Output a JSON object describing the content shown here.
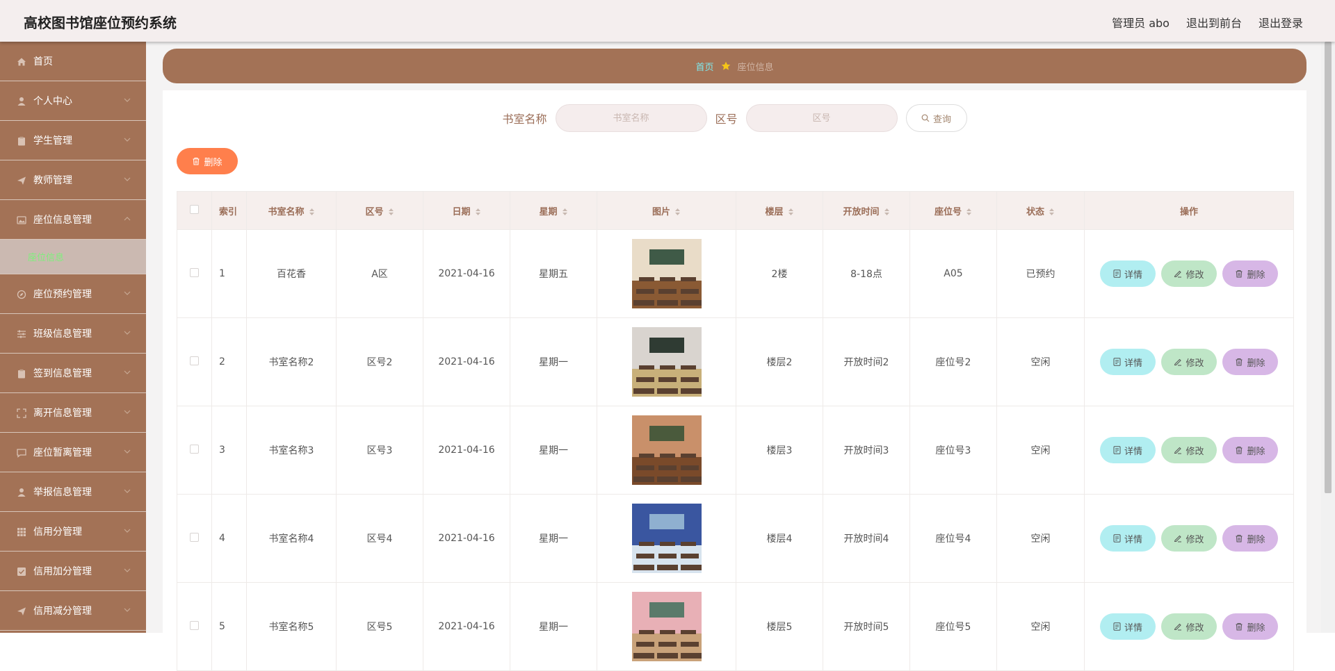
{
  "app": {
    "title": "高校图书馆座位预约系统"
  },
  "header": {
    "user_label": "管理员 abo",
    "to_front_label": "退出到前台",
    "logout_label": "退出登录"
  },
  "sidebar": {
    "items": [
      {
        "label": "首页",
        "icon": "home-icon"
      },
      {
        "label": "个人中心",
        "icon": "user-icon"
      },
      {
        "label": "学生管理",
        "icon": "clipboard-icon"
      },
      {
        "label": "教师管理",
        "icon": "send-icon"
      },
      {
        "label": "座位信息管理",
        "icon": "picture-icon",
        "expanded": true
      },
      {
        "label": "座位预约管理",
        "icon": "compass-icon"
      },
      {
        "label": "班级信息管理",
        "icon": "sliders-icon"
      },
      {
        "label": "签到信息管理",
        "icon": "clipboard-icon"
      },
      {
        "label": "离开信息管理",
        "icon": "fullscreen-icon"
      },
      {
        "label": "座位暂离管理",
        "icon": "message-icon"
      },
      {
        "label": "举报信息管理",
        "icon": "user-icon"
      },
      {
        "label": "信用分管理",
        "icon": "grid-icon"
      },
      {
        "label": "信用加分管理",
        "icon": "checklist-icon"
      },
      {
        "label": "信用减分管理",
        "icon": "send-icon"
      }
    ],
    "submenu": {
      "label": "座位信息"
    }
  },
  "breadcrumb": {
    "home": "首页",
    "current": "座位信息"
  },
  "search": {
    "room_label": "书室名称",
    "room_placeholder": "书室名称",
    "area_label": "区号",
    "area_placeholder": "区号",
    "button": "查询"
  },
  "actions": {
    "delete_label": "删除"
  },
  "table": {
    "columns": [
      "索引",
      "书室名称",
      "区号",
      "日期",
      "星期",
      "图片",
      "楼层",
      "开放时间",
      "座位号",
      "状态",
      "操作"
    ],
    "op_labels": {
      "detail": "详情",
      "edit": "修改",
      "delete": "删除"
    },
    "rows": [
      {
        "index": "1",
        "room": "百花香",
        "area": "A区",
        "date": "2021-04-16",
        "weekday": "星期五",
        "floor": "2楼",
        "open": "8-18点",
        "seat": "A05",
        "status": "已预约"
      },
      {
        "index": "2",
        "room": "书室名称2",
        "area": "区号2",
        "date": "2021-04-16",
        "weekday": "星期一",
        "floor": "楼层2",
        "open": "开放时间2",
        "seat": "座位号2",
        "status": "空闲"
      },
      {
        "index": "3",
        "room": "书室名称3",
        "area": "区号3",
        "date": "2021-04-16",
        "weekday": "星期一",
        "floor": "楼层3",
        "open": "开放时间3",
        "seat": "座位号3",
        "status": "空闲"
      },
      {
        "index": "4",
        "room": "书室名称4",
        "area": "区号4",
        "date": "2021-04-16",
        "weekday": "星期一",
        "floor": "楼层4",
        "open": "开放时间4",
        "seat": "座位号4",
        "status": "空闲"
      },
      {
        "index": "5",
        "room": "书室名称5",
        "area": "区号5",
        "date": "2021-04-16",
        "weekday": "星期一",
        "floor": "楼层5",
        "open": "开放时间5",
        "seat": "座位号5",
        "status": "空闲"
      }
    ]
  },
  "colors": {
    "sidebar": "#a37256",
    "header": "#f4eeee",
    "accent_orange": "#ff7f4c",
    "detail": "#b1eef1",
    "edit": "#bfe6c7",
    "delete": "#d7b7e6"
  }
}
